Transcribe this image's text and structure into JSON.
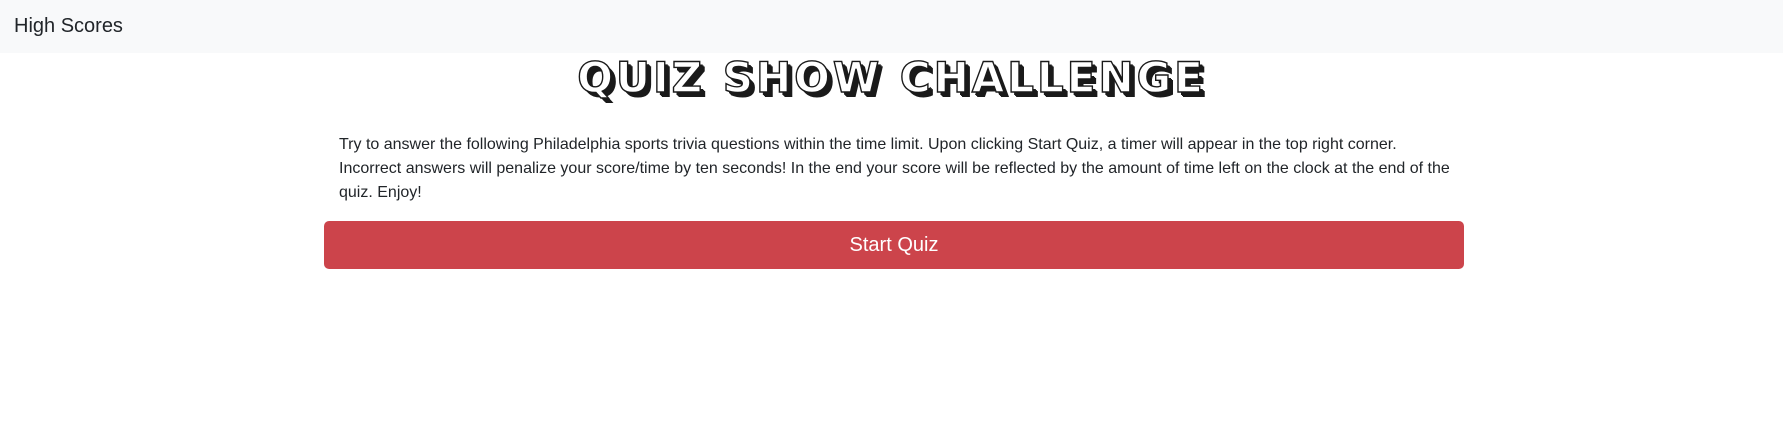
{
  "navbar": {
    "high_scores_label": "High Scores"
  },
  "main": {
    "title": "QUIZ SHOW CHALLENGE",
    "description": "Try to answer the following Philadelphia sports trivia questions within the time limit. Upon clicking Start Quiz, a timer will appear in the top right corner. Incorrect answers will penalize your score/time by ten seconds! In the end your score will be reflected by the amount of time left on the clock at the end of the quiz. Enjoy!",
    "start_button_label": "Start Quiz"
  },
  "colors": {
    "navbar_bg": "#f8f9fa",
    "button_bg": "#cc444b",
    "text": "#212529"
  }
}
